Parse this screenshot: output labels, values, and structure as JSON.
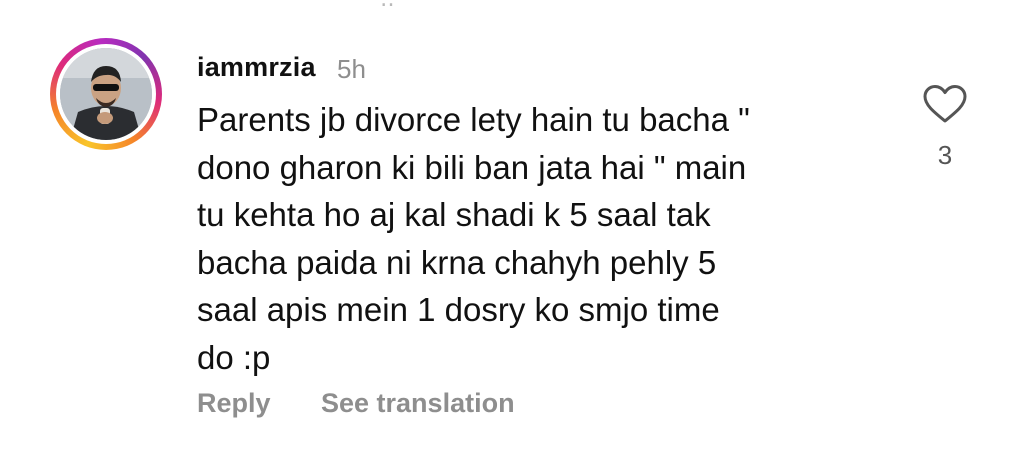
{
  "comment": {
    "username": "iammrzia",
    "time": "5h",
    "text_lines": [
      "Parents jb divorce lety hain tu bacha \"",
      "dono gharon ki bili ban jata hai \" main",
      "tu kehta ho aj kal shadi k 5 saal tak",
      "bacha paida ni krna chahyh pehly 5",
      "saal apis mein 1 dosry ko smjo time",
      "do :p"
    ],
    "reply_label": "Reply",
    "translate_label": "See translation",
    "like_count": "3",
    "like_icon": "heart-outline-icon"
  },
  "colors": {
    "text": "#111111",
    "secondary": "#8e8e8e",
    "story_ring": [
      "#f9c52a",
      "#f58529",
      "#dd2a7b",
      "#8134af"
    ]
  }
}
